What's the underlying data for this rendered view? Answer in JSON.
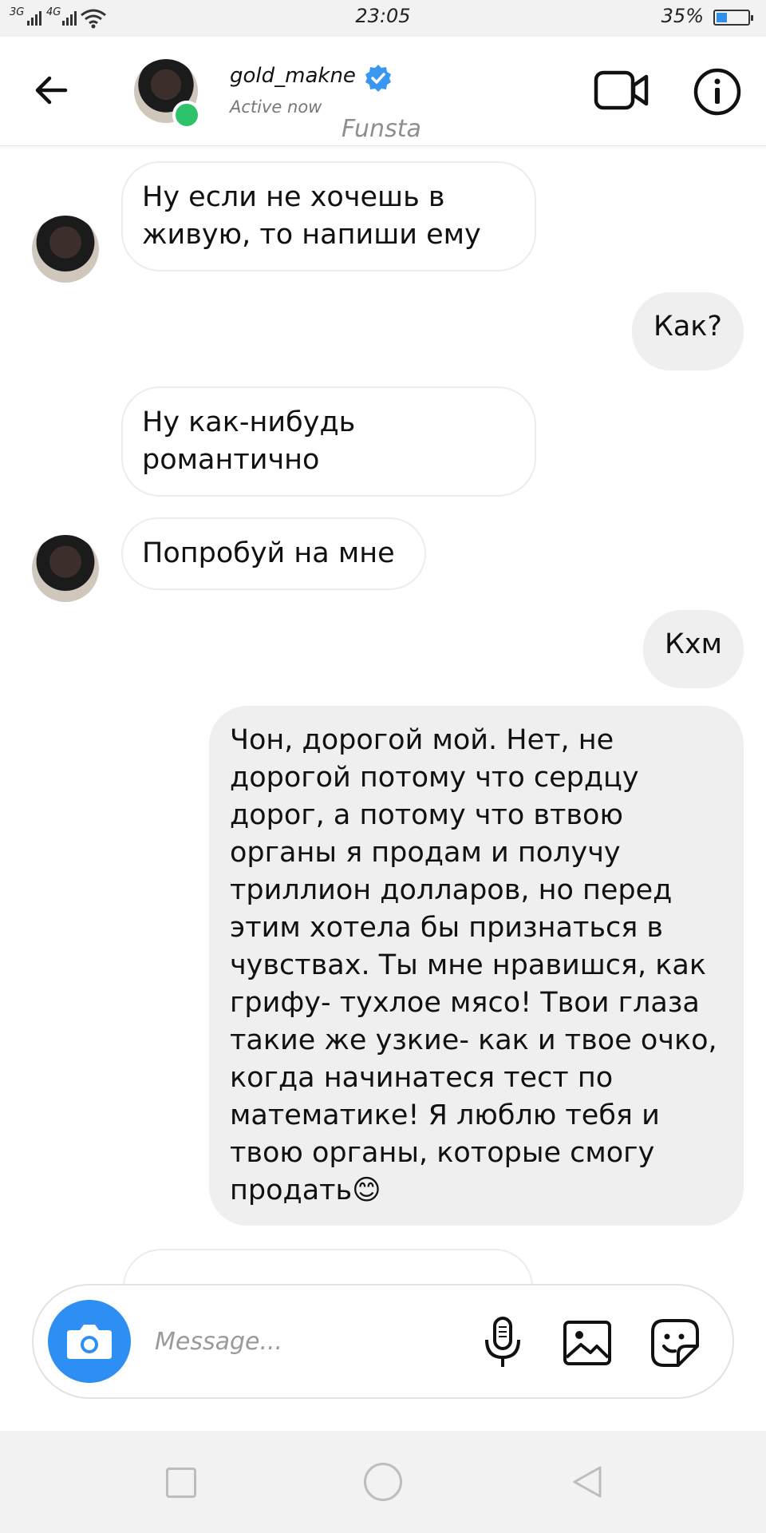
{
  "status_bar": {
    "network1": "3G",
    "network2": "4G",
    "time": "23:05",
    "battery_text": "35%",
    "battery_level": 0.35
  },
  "header": {
    "username": "gold_makne",
    "status": "Active now",
    "watermark": "Funsta",
    "icons": [
      "back-arrow-icon",
      "verified-badge-icon",
      "video-call-icon",
      "info-icon"
    ]
  },
  "messages": [
    {
      "side": "in",
      "text": "Ну если не хочешь в живую, то напиши ему"
    },
    {
      "side": "out",
      "text": "Как?"
    },
    {
      "side": "in",
      "text": "Ну как-нибудь романтично"
    },
    {
      "side": "in",
      "text": "Попробуй на мне"
    },
    {
      "side": "out",
      "text": "Кхм"
    },
    {
      "side": "out",
      "text": "Чон, дорогой мой. Нет, не дорогой потому что сердцу дорог, а потому что втвою органы я продам и получу триллион долларов, но перед этим хотела бы признаться в чувствах. Ты мне нравишся, как грифу- тухлое мясо! Твои глаза такие же узкие- как и твое очко, когда начинатеся тест по математике! Я люблю тебя и твою органы, которые смогу продать😊"
    }
  ],
  "composer": {
    "placeholder": "Message...",
    "icons": [
      "camera-icon",
      "microphone-icon",
      "gallery-icon",
      "sticker-icon"
    ],
    "camera_color": "#2d8ef4"
  },
  "navbar": {
    "icons": [
      "recent-apps-icon",
      "home-icon",
      "back-triangle-icon"
    ]
  },
  "colors": {
    "online": "#2ec36b",
    "verified": "#3897f0",
    "outgoing_bubble": "#efefef"
  }
}
